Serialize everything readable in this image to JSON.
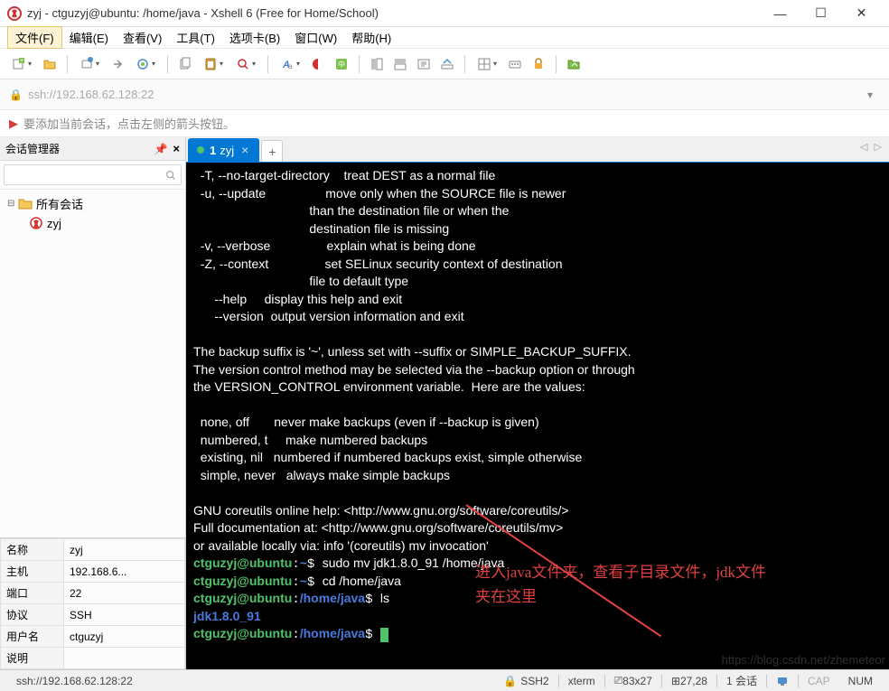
{
  "window": {
    "title": "zyj - ctguzyj@ubuntu: /home/java - Xshell 6 (Free for Home/School)"
  },
  "menu": {
    "file": "文件(F)",
    "edit": "编辑(E)",
    "view": "查看(V)",
    "tools": "工具(T)",
    "tabs": "选项卡(B)",
    "window": "窗口(W)",
    "help": "帮助(H)"
  },
  "address": {
    "url": "ssh://192.168.62.128:22"
  },
  "hint": {
    "text": "要添加当前会话，点击左侧的箭头按钮。"
  },
  "sidebar": {
    "title": "会话管理器",
    "root": "所有会话",
    "session": "zyj",
    "props": [
      {
        "k": "名称",
        "v": "zyj"
      },
      {
        "k": "主机",
        "v": "192.168.6..."
      },
      {
        "k": "端口",
        "v": "22"
      },
      {
        "k": "协议",
        "v": "SSH"
      },
      {
        "k": "用户名",
        "v": "ctguzyj"
      },
      {
        "k": "说明",
        "v": ""
      }
    ]
  },
  "tab": {
    "num": "1",
    "name": "zyj"
  },
  "term": {
    "l1": "  -T, --no-target-directory    treat DEST as a normal file",
    "l2": "  -u, --update                 move only when the SOURCE file is newer",
    "l3": "                                 than the destination file or when the",
    "l4": "                                 destination file is missing",
    "l5": "  -v, --verbose                explain what is being done",
    "l6": "  -Z, --context                set SELinux security context of destination",
    "l7": "                                 file to default type",
    "l8": "      --help     display this help and exit",
    "l9": "      --version  output version information and exit",
    "l10": "",
    "l11": "The backup suffix is '~', unless set with --suffix or SIMPLE_BACKUP_SUFFIX.",
    "l12": "The version control method may be selected via the --backup option or through",
    "l13": "the VERSION_CONTROL environment variable.  Here are the values:",
    "l14": "",
    "l15": "  none, off       never make backups (even if --backup is given)",
    "l16": "  numbered, t     make numbered backups",
    "l17": "  existing, nil   numbered if numbered backups exist, simple otherwise",
    "l18": "  simple, never   always make simple backups",
    "l19": "",
    "l20": "GNU coreutils online help: <http://www.gnu.org/software/coreutils/>",
    "l21": "Full documentation at: <http://www.gnu.org/software/coreutils/mv>",
    "l22": "or available locally via: info '(coreutils) mv invocation'",
    "p1host": "ctguzyj@ubuntu",
    "p1path": "~",
    "p1cmd": "sudo mv jdk1.8.0_91 /home/java",
    "p2host": "ctguzyj@ubuntu",
    "p2path": "~",
    "p2cmd": "cd /home/java",
    "p3host": "ctguzyj@ubuntu",
    "p3path": "/home/java",
    "p3cmd": "ls",
    "out1": "jdk1.8.0_91",
    "p4host": "ctguzyj@ubuntu",
    "p4path": "/home/java"
  },
  "annot": {
    "text": "进入java文件夹，查看子目录文件，jdk文件夹在这里"
  },
  "status": {
    "addr": "ssh://192.168.62.128:22",
    "proto": "SSH2",
    "term": "xterm",
    "size": "83x27",
    "pos": "27,28",
    "sess_label": "1 会话",
    "cap": "CAP",
    "num": "NUM",
    "watermark": "https://blog.csdn.net/zhemeteor"
  }
}
